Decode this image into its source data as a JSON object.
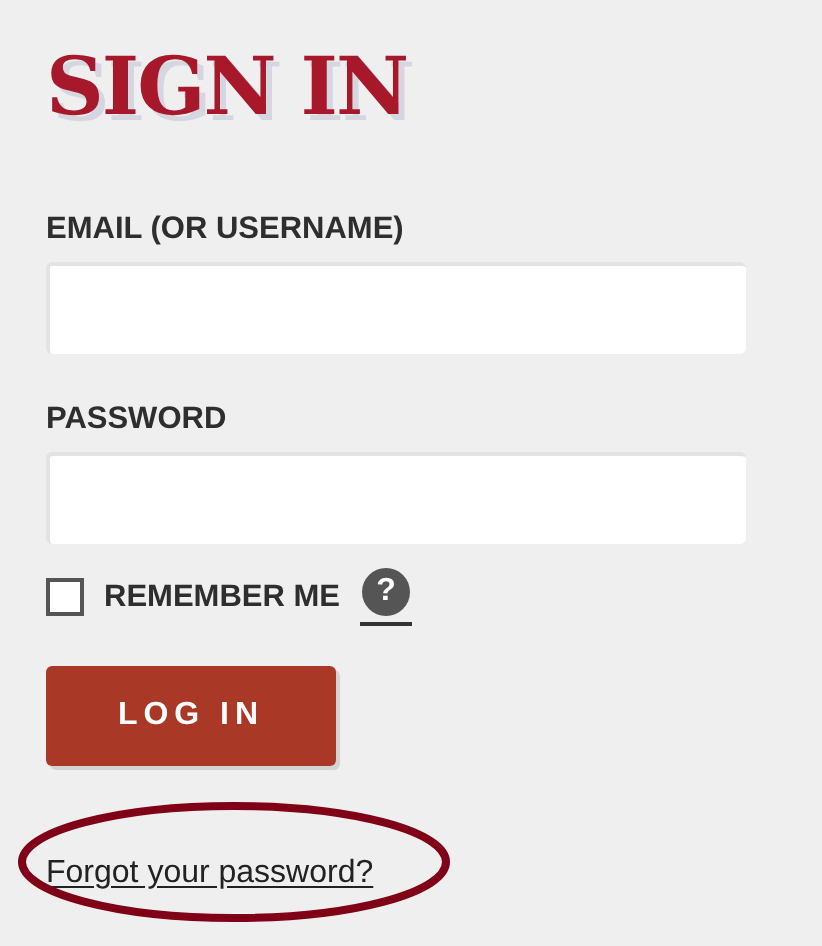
{
  "title": "SIGN IN",
  "fields": [
    {
      "label": "EMAIL (OR USERNAME)"
    },
    {
      "label": "PASSWORD"
    }
  ],
  "remember": {
    "label": "REMEMBER ME",
    "checked": false,
    "help": "?"
  },
  "button": "LOG IN",
  "forgot_link": {
    "label": "Forgot your password?",
    "circled": true
  }
}
